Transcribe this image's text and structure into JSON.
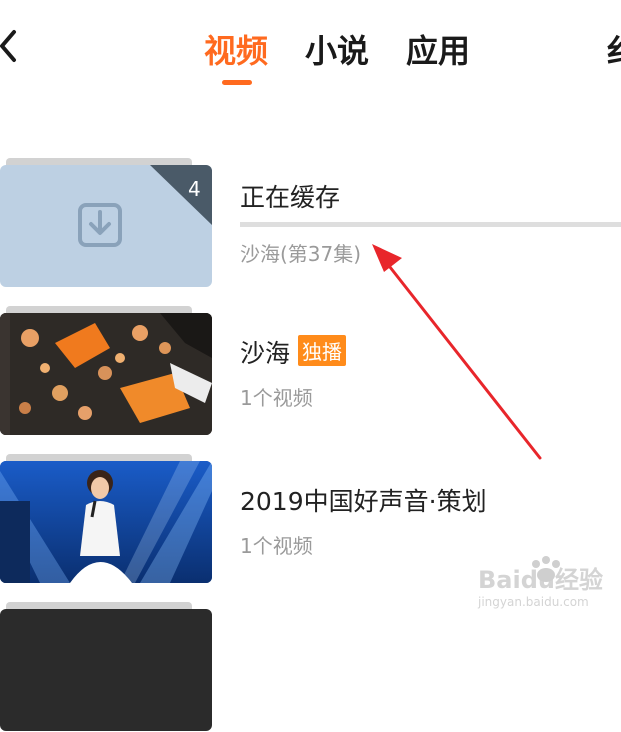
{
  "header": {
    "back_icon": "chevron-left-icon",
    "tabs": [
      {
        "label": "视频",
        "active": true
      },
      {
        "label": "小说",
        "active": false
      },
      {
        "label": "应用",
        "active": false
      }
    ],
    "tab_overflow_label": "纟",
    "accent_color": "#ff6a1f"
  },
  "downloads": [
    {
      "title": "正在缓存",
      "subtitle": "沙海(第37集)",
      "count": "4",
      "icon": "download-icon",
      "progress": 0
    },
    {
      "title": "沙海",
      "badge": "独播",
      "subtitle": "1个视频"
    },
    {
      "title": "2019中国好声音·策划",
      "subtitle": "1个视频"
    }
  ],
  "watermark": {
    "brand": "Baidu经验",
    "url": "jingyan.baidu.com"
  }
}
